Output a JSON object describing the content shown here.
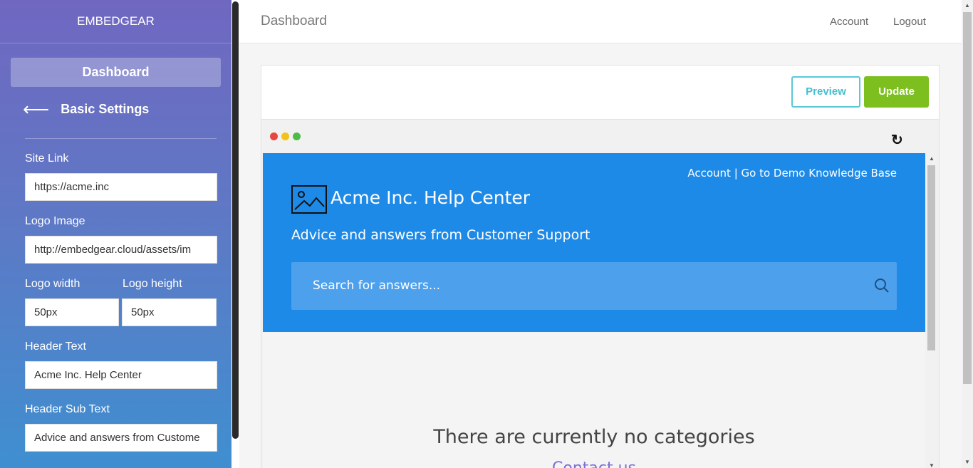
{
  "sidebar": {
    "brand": "EMBEDGEAR",
    "nav_dashboard": "Dashboard",
    "back_label": "Basic Settings",
    "back_arrow": "⟵",
    "fields": {
      "site_link": {
        "label": "Site Link",
        "value": "https://acme.inc"
      },
      "logo_image": {
        "label": "Logo Image",
        "value": "http://embedgear.cloud/assets/im"
      },
      "logo_width": {
        "label": "Logo width",
        "value": "50px"
      },
      "logo_height": {
        "label": "Logo height",
        "value": "50px"
      },
      "header_text": {
        "label": "Header Text",
        "value": "Acme Inc. Help Center"
      },
      "header_sub_text": {
        "label": "Header Sub Text",
        "value": "Advice and answers from Custome"
      }
    }
  },
  "topbar": {
    "title": "Dashboard",
    "account": "Account",
    "logout": "Logout"
  },
  "toolbar": {
    "preview": "Preview",
    "update": "Update"
  },
  "browser": {
    "dot_colors": [
      "#e8473f",
      "#f3c11b",
      "#4cbb47"
    ],
    "refresh_icon": "↻"
  },
  "preview": {
    "links": "Account | Go to Demo Knowledge Base",
    "title": "Acme Inc. Help Center",
    "subtitle": "Advice and answers from Customer Support",
    "search_placeholder": "Search for answers...",
    "no_categories": "There are currently no categories",
    "contact": "Contact us",
    "hero_color": "#1e8ae8"
  },
  "colors": {
    "preview_accent": "#45bfd0",
    "update_green": "#7dbf1f"
  }
}
